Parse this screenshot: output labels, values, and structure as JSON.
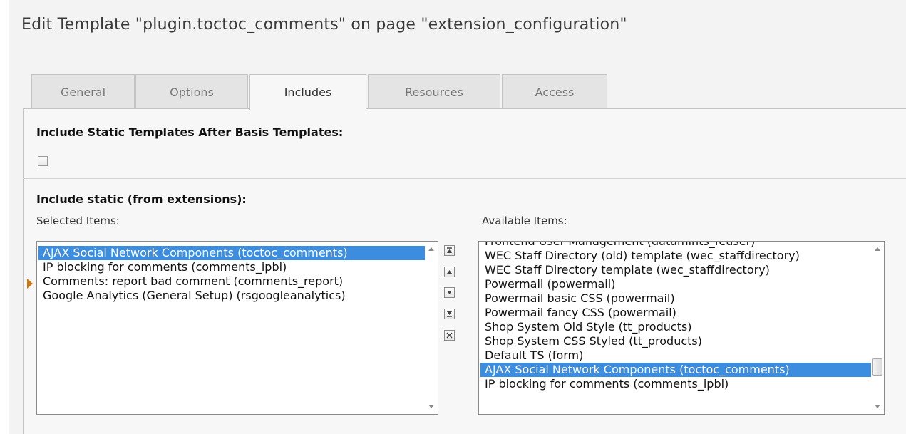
{
  "page": {
    "title": "Edit Template \"plugin.toctoc_comments\" on page \"extension_configuration\""
  },
  "tabs": [
    {
      "label": "General",
      "active": false
    },
    {
      "label": "Options",
      "active": false
    },
    {
      "label": "Includes",
      "active": true
    },
    {
      "label": "Resources",
      "active": false
    },
    {
      "label": "Access",
      "active": false
    }
  ],
  "include_static_after_basis": {
    "label": "Include Static Templates After Basis Templates:",
    "checked": false
  },
  "include_static": {
    "title": "Include static (from extensions):",
    "selected_label": "Selected Items:",
    "available_label": "Available Items:",
    "selected_items": [
      {
        "text": "AJAX Social Network Components (toctoc_comments)",
        "selected": true
      },
      {
        "text": "IP blocking for comments (comments_ipbl)",
        "selected": false
      },
      {
        "text": "Comments: report bad comment (comments_report)",
        "selected": false
      },
      {
        "text": "Google Analytics (General Setup) (rsgoogleanalytics)",
        "selected": false
      }
    ],
    "available_items": [
      {
        "text": "Frontend User Management (datamints_feuser)",
        "selected": false
      },
      {
        "text": "WEC Staff Directory (old) template (wec_staffdirectory)",
        "selected": false
      },
      {
        "text": "WEC Staff Directory template (wec_staffdirectory)",
        "selected": false
      },
      {
        "text": "Powermail (powermail)",
        "selected": false
      },
      {
        "text": "Powermail basic CSS (powermail)",
        "selected": false
      },
      {
        "text": "Powermail fancy CSS (powermail)",
        "selected": false
      },
      {
        "text": "Shop System Old Style (tt_products)",
        "selected": false
      },
      {
        "text": "Shop System CSS Styled (tt_products)",
        "selected": false
      },
      {
        "text": "Default TS (form)",
        "selected": false
      },
      {
        "text": "AJAX Social Network Components (toctoc_comments)",
        "selected": true
      },
      {
        "text": "IP blocking for comments (comments_ipbl)",
        "selected": false
      }
    ],
    "selected_scroll_position": 0,
    "available_scroll_position": 0.8
  },
  "icons": {
    "move_top": "move-to-top-icon",
    "move_up": "move-up-icon",
    "move_down": "move-down-icon",
    "move_bottom": "move-to-bottom-icon",
    "remove": "remove-icon",
    "marker": "current-item-marker-icon"
  },
  "colors": {
    "selection": "#3c8de0",
    "marker": "#c9781b"
  }
}
